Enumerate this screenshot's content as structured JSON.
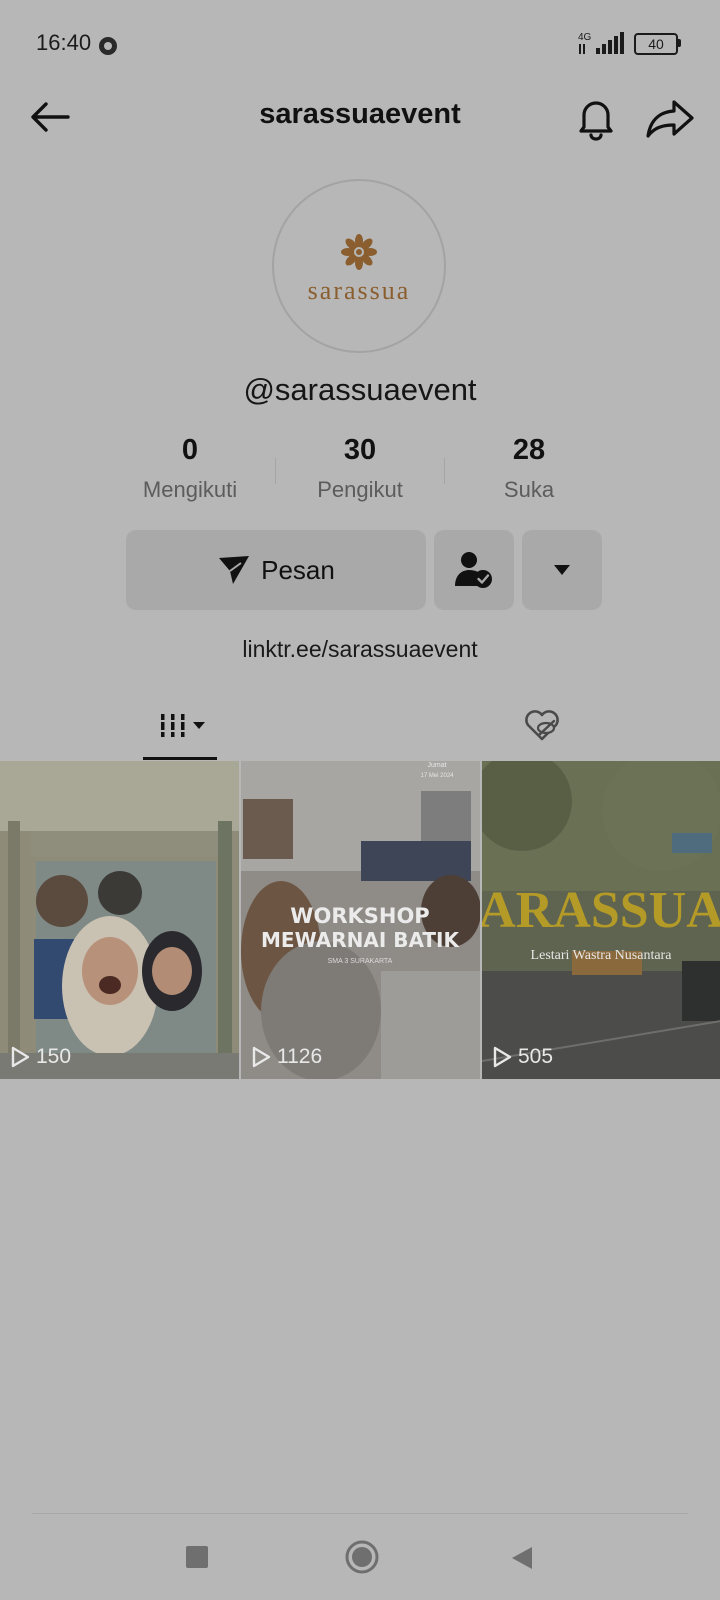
{
  "status_bar": {
    "time": "16:40",
    "network": "4G",
    "battery": "40"
  },
  "header": {
    "title": "sarassuaevent"
  },
  "profile": {
    "avatar_text": "sarassua",
    "username": "@sarassuaevent",
    "stats": [
      {
        "value": "0",
        "label": "Mengikuti"
      },
      {
        "value": "30",
        "label": "Pengikut"
      },
      {
        "value": "28",
        "label": "Suka"
      }
    ],
    "message_button": "Pesan",
    "link": "linktr.ee/sarassuaevent"
  },
  "videos": [
    {
      "views": "150"
    },
    {
      "views": "1126",
      "overlay_title_line1": "WORKSHOP",
      "overlay_title_line2": "MEWARNAI BATIK",
      "overlay_sub": "SMA 3 SURAKARTA",
      "overlay_date_1": "Jumat",
      "overlay_date_2": "17 Mei 2024"
    },
    {
      "views": "505",
      "overlay_title": "ARASSUA",
      "overlay_sub": "Lestari Wastra Nusantara"
    }
  ],
  "colors": {
    "background": "#b7b7b7",
    "button": "#a9a9a9",
    "brand": "#8a5e2e"
  }
}
